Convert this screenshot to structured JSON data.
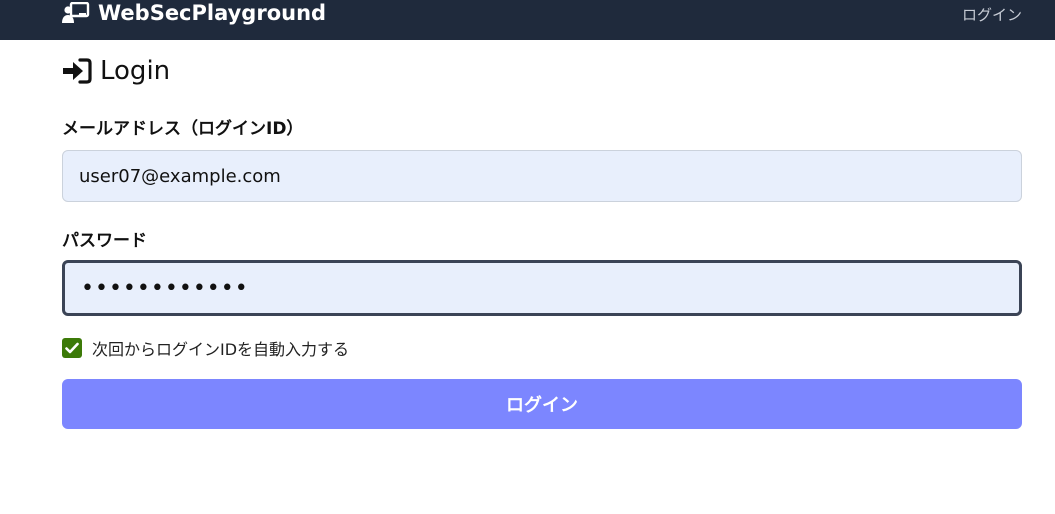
{
  "navbar": {
    "brand": "WebSecPlayground",
    "login_link": "ログイン",
    "brand_icon": "chalkboard-user-icon"
  },
  "page": {
    "title": "Login",
    "title_icon": "sign-in-icon"
  },
  "form": {
    "email_label": "メールアドレス（ログインID）",
    "email_value": "user07@example.com",
    "password_label": "パスワード",
    "password_value": "••••••••••••",
    "remember_label": "次回からログインIDを自動入力する",
    "remember_checked": true,
    "submit_label": "ログイン"
  },
  "colors": {
    "navbar_bg": "#1f2a3c",
    "input_bg": "#e8effc",
    "checkbox": "#3c7a08",
    "button": "#7c86ff"
  }
}
